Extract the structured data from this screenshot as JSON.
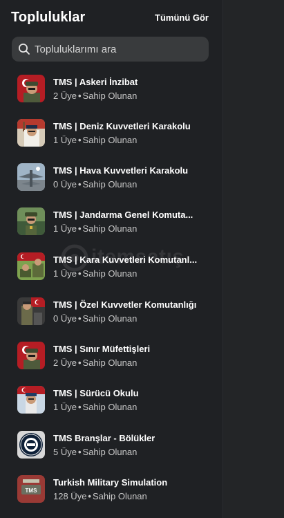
{
  "header": {
    "title": "Topluluklar",
    "see_all": "Tümünü Gör"
  },
  "search": {
    "placeholder": "Topluluklarımı ara"
  },
  "watermark": "itemsatış",
  "communities": [
    {
      "name": "TMS | Askeri İnzibat",
      "members": "2 Üye",
      "role": "Sahip Olunan",
      "thumb": "soldier-flag"
    },
    {
      "name": "TMS | Deniz Kuvvetleri Karakolu",
      "members": "1 Üye",
      "role": "Sahip Olunan",
      "thumb": "naval"
    },
    {
      "name": "TMS | Hava Kuvvetleri Karakolu",
      "members": "0 Üye",
      "role": "Sahip Olunan",
      "thumb": "jets"
    },
    {
      "name": "TMS | Jandarma Genel Komuta...",
      "members": "1 Üye",
      "role": "Sahip Olunan",
      "thumb": "gendarme"
    },
    {
      "name": "TMS | Kara Kuvvetleri Komutanl...",
      "members": "1 Üye",
      "role": "Sahip Olunan",
      "thumb": "land"
    },
    {
      "name": "TMS | Özel Kuvvetler Komutanlığı",
      "members": "0 Üye",
      "role": "Sahip Olunan",
      "thumb": "special"
    },
    {
      "name": "TMS | Sınır Müfettişleri",
      "members": "2 Üye",
      "role": "Sahip Olunan",
      "thumb": "soldier-flag"
    },
    {
      "name": "TMS | Sürücü Okulu",
      "members": "1 Üye",
      "role": "Sahip Olunan",
      "thumb": "driver"
    },
    {
      "name": "TMS Branşlar - Bölükler",
      "members": "5 Üye",
      "role": "Sahip Olunan",
      "thumb": "emblem"
    },
    {
      "name": "Turkish Military Simulation",
      "members": "128 Üye",
      "role": "Sahip Olunan",
      "thumb": "tms-logo"
    }
  ]
}
